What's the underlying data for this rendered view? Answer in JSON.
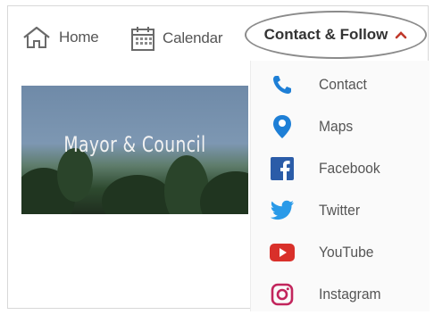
{
  "nav": {
    "home_label": "Home",
    "calendar_label": "Calendar",
    "contact_follow_label": "Contact & Follow"
  },
  "hero": {
    "title": "Mayor & Council"
  },
  "dropdown": {
    "items": [
      {
        "label": "Contact",
        "icon": "phone-icon",
        "color": "#1e7fd6"
      },
      {
        "label": "Maps",
        "icon": "map-pin-icon",
        "color": "#1e7fd6"
      },
      {
        "label": "Facebook",
        "icon": "facebook-icon",
        "color": "#2b5ca8"
      },
      {
        "label": "Twitter",
        "icon": "twitter-icon",
        "color": "#2a9ae8"
      },
      {
        "label": "YouTube",
        "icon": "youtube-icon",
        "color": "#d9302a"
      },
      {
        "label": "Instagram",
        "icon": "instagram-icon",
        "color": "#c2255c"
      }
    ]
  },
  "colors": {
    "accent_caret": "#c0392b",
    "text": "#555555"
  }
}
